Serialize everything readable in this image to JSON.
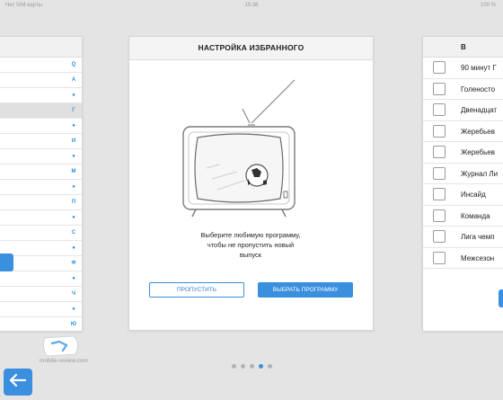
{
  "status_bar": {
    "carrier": "Нет SIM-карты",
    "time": "15:38",
    "battery": "100 %"
  },
  "left_panel": {
    "index_letters": [
      "Q",
      "А",
      "●",
      "Г",
      "●",
      "И",
      "●",
      "М",
      "●",
      "П",
      "●",
      "С",
      "●",
      "Ф",
      "●",
      "Ч",
      "●",
      "Ю"
    ]
  },
  "center_panel": {
    "title": "НАСТРОЙКА ИЗБРАННОГО",
    "message_lines": [
      "Выберите любимую программу,",
      "чтобы не пропустить новый",
      "выпуск"
    ],
    "skip_button": "ПРОПУСТИТЬ",
    "choose_button": "ВЫБРАТЬ ПРОГРАММУ",
    "illustration": "tv-with-football-icon"
  },
  "right_panel": {
    "title_fragment": "В",
    "programs": [
      "90 минут Г",
      "Голеносто",
      "Двенадцат",
      "Жеребьев",
      "Жеребьев",
      "Журнал Ли",
      "Инсайд",
      "Команда",
      "Лига чемп",
      "Межсезон"
    ]
  },
  "pager": {
    "total": 5,
    "current": 4
  },
  "watermark": "mobile-review.com",
  "colors": {
    "accent": "#3a8fde",
    "background": "#e4e4e4"
  }
}
